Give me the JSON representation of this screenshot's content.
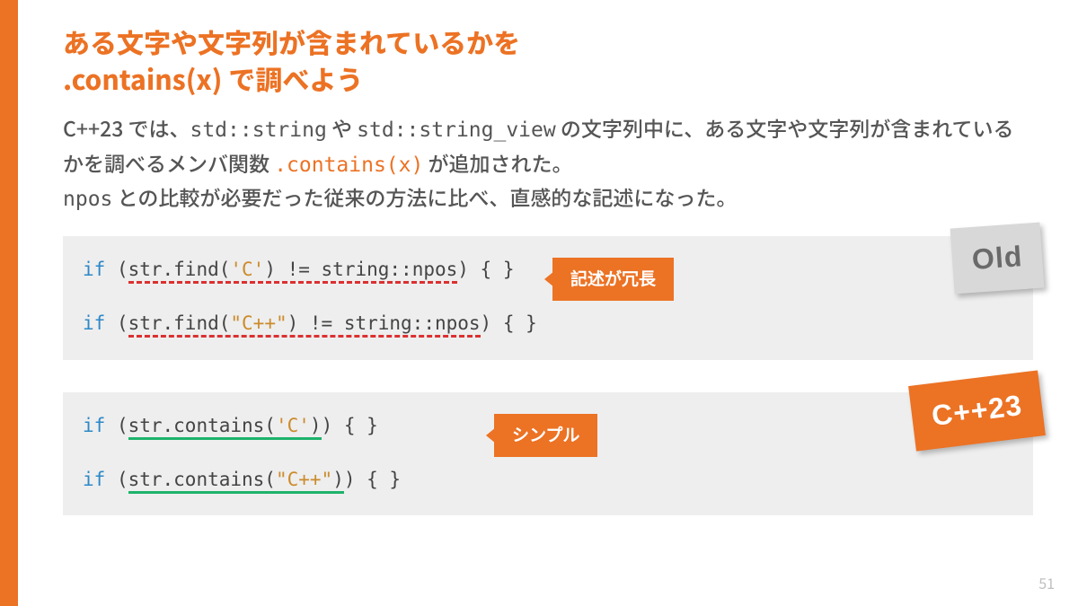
{
  "title_line1": "ある文字や文字列が含まれているかを",
  "title_line2": ".contains(x) で調べよう",
  "body": {
    "p1a": "C++23 では、",
    "p1b": "std::string",
    "p1c": " や ",
    "p1d": "std::string_view",
    "p1e": " の文字列中に、ある文字や文字列が含まれているかを調べるメンバ関数 ",
    "p1f": ".contains(x)",
    "p1g": " が追加された。",
    "p2a": "npos",
    "p2b": " との比較が必要だった従来の方法に比べ、直感的な記述になった。"
  },
  "old_code": {
    "l1_if": "if",
    "l1_open": " (",
    "l1_expr_a": "str.find(",
    "l1_expr_b": "'C'",
    "l1_expr_c": ") != string::npos",
    "l1_close": ") { }",
    "l2_if": "if",
    "l2_open": " (",
    "l2_expr_a": "str.find(",
    "l2_expr_b": "\"C++\"",
    "l2_expr_c": ") != string::npos",
    "l2_close": ") { }"
  },
  "new_code": {
    "l1_if": "if",
    "l1_open": " (",
    "l1_expr_a": "str.contains(",
    "l1_expr_b": "'C'",
    "l1_expr_c": ")",
    "l1_close": ") { }",
    "l2_if": "if",
    "l2_open": " (",
    "l2_expr_a": "str.contains(",
    "l2_expr_b": "\"C++\"",
    "l2_expr_c": ")",
    "l2_close": ") { }"
  },
  "callouts": {
    "old": "記述が冗長",
    "new": "シンプル"
  },
  "tags": {
    "old": "Old",
    "new": "C++23"
  },
  "page_number": "51"
}
